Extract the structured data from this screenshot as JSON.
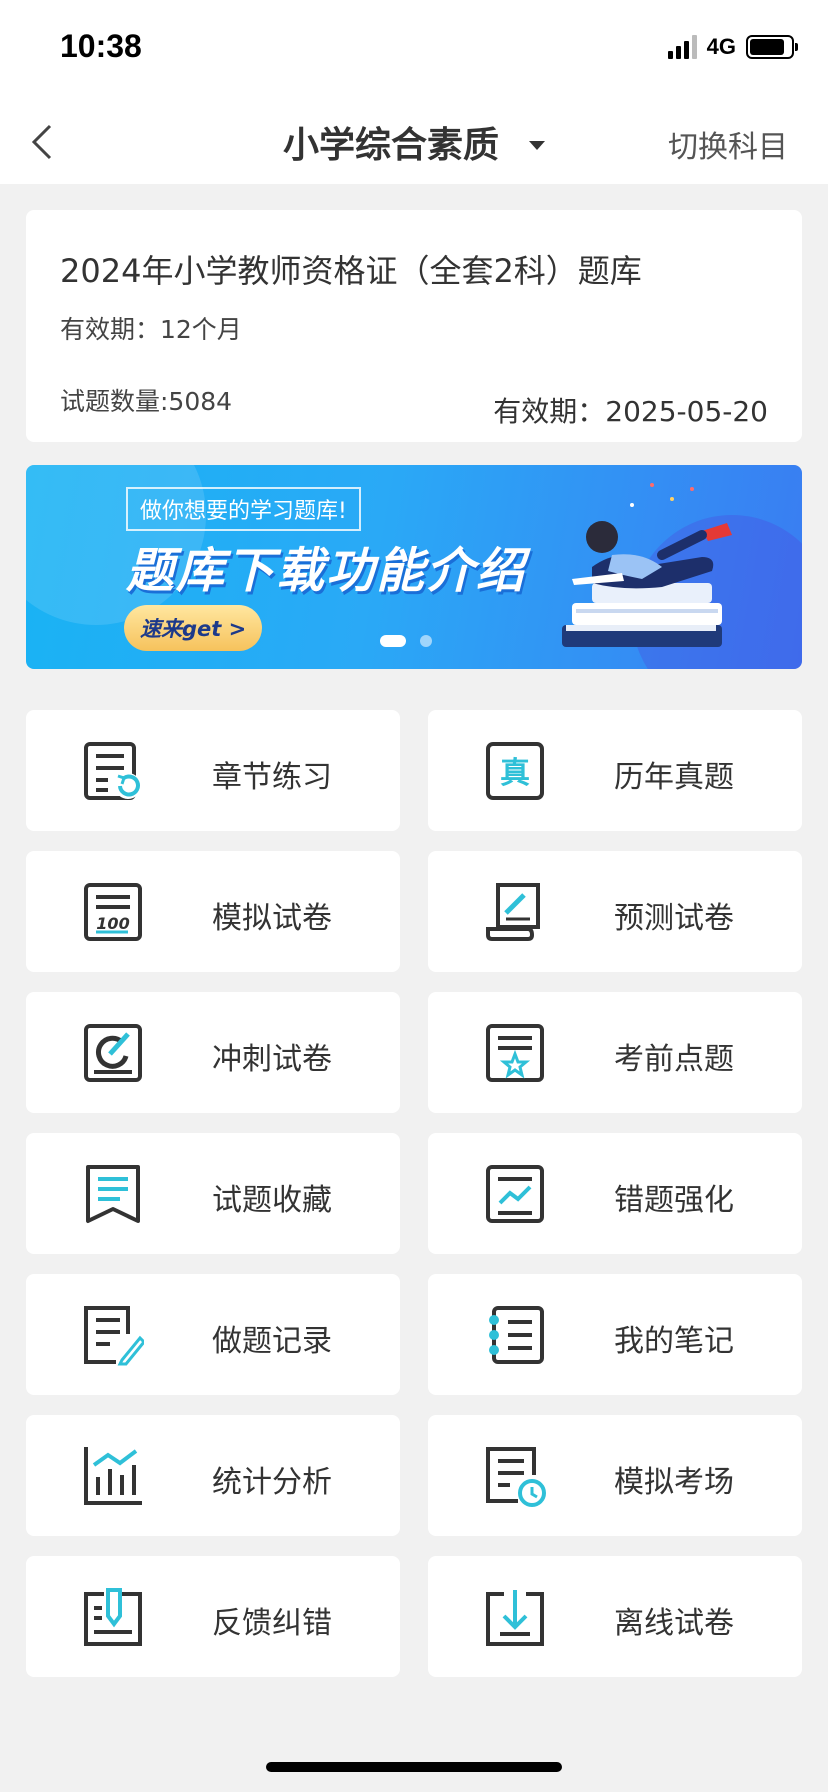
{
  "status_bar": {
    "time": "10:38",
    "network": "4G"
  },
  "nav": {
    "title": "小学综合素质",
    "switch_label": "切换科目"
  },
  "info_card": {
    "title": "2024年小学教师资格证（全套2科）题库",
    "validity": "有效期：12个月",
    "question_count": "试题数量:5084",
    "expiry": "有效期：2025-05-20"
  },
  "banner": {
    "tagline": "做你想要的学习题库!",
    "headline": "题库下载功能介绍",
    "cta": "速来get >"
  },
  "colors": {
    "accent": "#2fc0d8",
    "icon_stroke": "#333333",
    "banner_start": "#19b3f4",
    "banner_end": "#3a7cf2"
  },
  "tiles": [
    {
      "label": "章节练习",
      "icon": "chapter-practice-icon"
    },
    {
      "label": "历年真题",
      "icon": "past-exams-icon"
    },
    {
      "label": "模拟试卷",
      "icon": "mock-paper-icon"
    },
    {
      "label": "预测试卷",
      "icon": "prediction-paper-icon"
    },
    {
      "label": "冲刺试卷",
      "icon": "sprint-paper-icon"
    },
    {
      "label": "考前点题",
      "icon": "pre-exam-tips-icon"
    },
    {
      "label": "试题收藏",
      "icon": "favorites-icon"
    },
    {
      "label": "错题强化",
      "icon": "mistake-review-icon"
    },
    {
      "label": "做题记录",
      "icon": "practice-record-icon"
    },
    {
      "label": "我的笔记",
      "icon": "notes-icon"
    },
    {
      "label": "统计分析",
      "icon": "statistics-icon"
    },
    {
      "label": "模拟考场",
      "icon": "mock-exam-room-icon"
    },
    {
      "label": "反馈纠错",
      "icon": "feedback-icon"
    },
    {
      "label": "离线试卷",
      "icon": "offline-download-icon"
    }
  ]
}
